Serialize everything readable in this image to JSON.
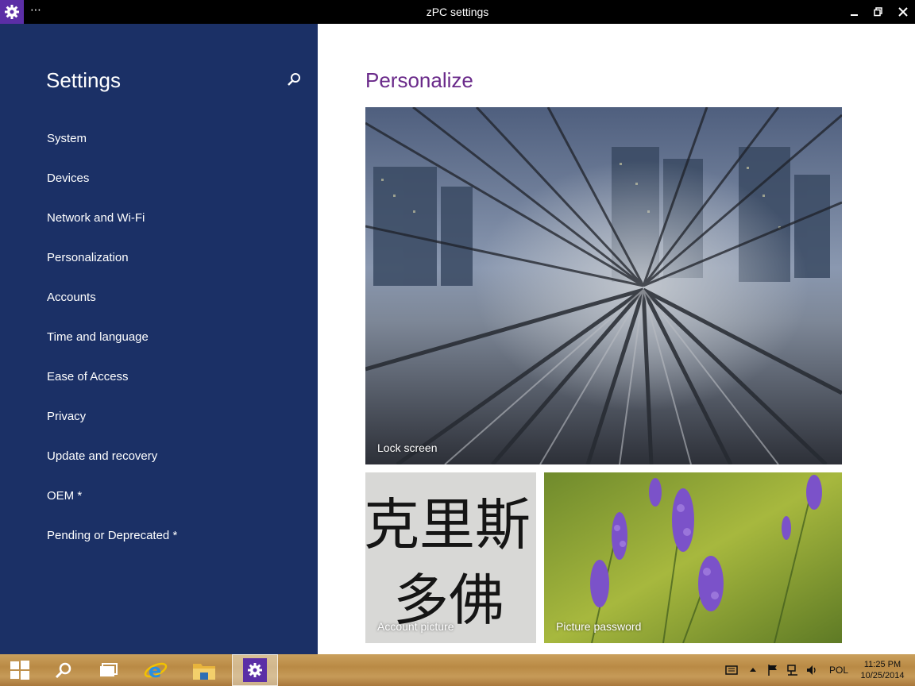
{
  "window": {
    "title": "zPC settings",
    "menu_glyph": "⋯"
  },
  "sidebar": {
    "title": "Settings",
    "items": [
      {
        "label": "System"
      },
      {
        "label": "Devices"
      },
      {
        "label": "Network and Wi-Fi"
      },
      {
        "label": "Personalization"
      },
      {
        "label": "Accounts"
      },
      {
        "label": "Time and language"
      },
      {
        "label": "Ease of Access"
      },
      {
        "label": "Privacy"
      },
      {
        "label": "Update and recovery"
      },
      {
        "label": "OEM *"
      },
      {
        "label": "Pending or Deprecated *"
      }
    ]
  },
  "main": {
    "heading": "Personalize",
    "tiles": {
      "lock_screen": "Lock screen",
      "account_picture": "Account picture",
      "picture_password": "Picture password",
      "account_picture_glyphs_row1": "克里斯",
      "account_picture_glyphs_row2": "多佛"
    }
  },
  "taskbar": {
    "language": "POL",
    "time": "11:25 PM",
    "date": "10/25/2014"
  },
  "colors": {
    "sidebar_bg": "#1b3066",
    "accent_purple": "#6a2a8a",
    "app_icon_bg": "#5b2ea6",
    "titlebar_bg": "#000000"
  },
  "icons": {
    "app": "gear-icon",
    "search": "search-icon",
    "start": "windows-logo-icon",
    "taskview": "task-view-icon",
    "ie": "internet-explorer-icon",
    "explorer": "folder-icon",
    "settings": "gear-icon"
  }
}
